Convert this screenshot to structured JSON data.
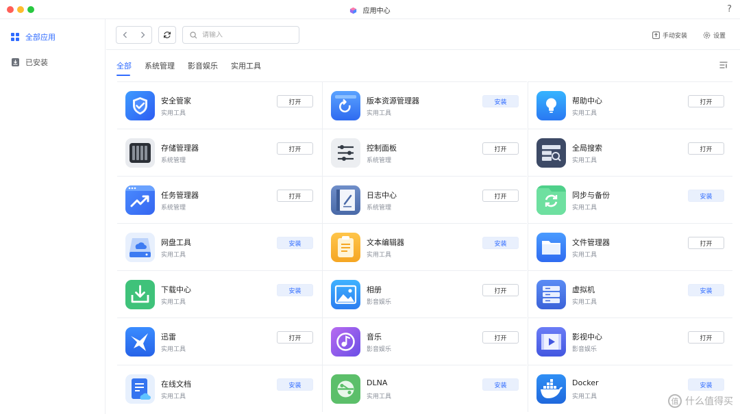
{
  "window": {
    "title": "应用中心",
    "help_label": "?"
  },
  "sidebar": {
    "items": [
      {
        "label": "全部应用",
        "icon": "grid-icon",
        "active": true
      },
      {
        "label": "已安装",
        "icon": "download-box-icon",
        "active": false
      }
    ]
  },
  "toolbar": {
    "back_icon": "chevron-left-icon",
    "forward_icon": "chevron-right-icon",
    "refresh_icon": "refresh-icon",
    "search_placeholder": "请输入",
    "manual_install_label": "手动安装",
    "settings_label": "设置"
  },
  "tabs": [
    {
      "label": "全部",
      "active": true
    },
    {
      "label": "系统管理",
      "active": false
    },
    {
      "label": "影音娱乐",
      "active": false
    },
    {
      "label": "实用工具",
      "active": false
    }
  ],
  "colors": {
    "accent": "#2f6bff",
    "install_bg": "#e9f0fd",
    "border": "#eceef2"
  },
  "apps": [
    {
      "name": "安全管家",
      "category": "实用工具",
      "action": "打开",
      "icon": "shield-icon"
    },
    {
      "name": "版本资源管理器",
      "category": "实用工具",
      "action": "安装",
      "icon": "version-icon"
    },
    {
      "name": "帮助中心",
      "category": "实用工具",
      "action": "打开",
      "icon": "lightbulb-icon"
    },
    {
      "name": "存储管理器",
      "category": "系统管理",
      "action": "打开",
      "icon": "storage-icon"
    },
    {
      "name": "控制面板",
      "category": "系统管理",
      "action": "打开",
      "icon": "sliders-icon"
    },
    {
      "name": "全局搜索",
      "category": "实用工具",
      "action": "打开",
      "icon": "global-search-icon"
    },
    {
      "name": "任务管理器",
      "category": "系统管理",
      "action": "打开",
      "icon": "task-chart-icon"
    },
    {
      "name": "日志中心",
      "category": "系统管理",
      "action": "打开",
      "icon": "log-book-icon"
    },
    {
      "name": "同步与备份",
      "category": "实用工具",
      "action": "安装",
      "icon": "sync-folder-icon"
    },
    {
      "name": "网盘工具",
      "category": "实用工具",
      "action": "安装",
      "icon": "cloud-drive-icon"
    },
    {
      "name": "文本编辑器",
      "category": "实用工具",
      "action": "安装",
      "icon": "text-editor-icon"
    },
    {
      "name": "文件管理器",
      "category": "实用工具",
      "action": "打开",
      "icon": "folder-icon"
    },
    {
      "name": "下载中心",
      "category": "实用工具",
      "action": "安装",
      "icon": "download-icon"
    },
    {
      "name": "相册",
      "category": "影音娱乐",
      "action": "打开",
      "icon": "photo-icon"
    },
    {
      "name": "虚拟机",
      "category": "实用工具",
      "action": "安装",
      "icon": "server-icon"
    },
    {
      "name": "迅雷",
      "category": "实用工具",
      "action": "打开",
      "icon": "thunder-bird-icon"
    },
    {
      "name": "音乐",
      "category": "影音娱乐",
      "action": "打开",
      "icon": "music-icon"
    },
    {
      "name": "影视中心",
      "category": "影音娱乐",
      "action": "打开",
      "icon": "video-icon"
    },
    {
      "name": "在线文档",
      "category": "实用工具",
      "action": "安装",
      "icon": "online-doc-icon"
    },
    {
      "name": "DLNA",
      "category": "实用工具",
      "action": "安装",
      "icon": "dlna-icon"
    },
    {
      "name": "Docker",
      "category": "实用工具",
      "action": "安装",
      "icon": "docker-whale-icon"
    }
  ],
  "watermark": {
    "text": "什么值得买",
    "logo": "值"
  }
}
